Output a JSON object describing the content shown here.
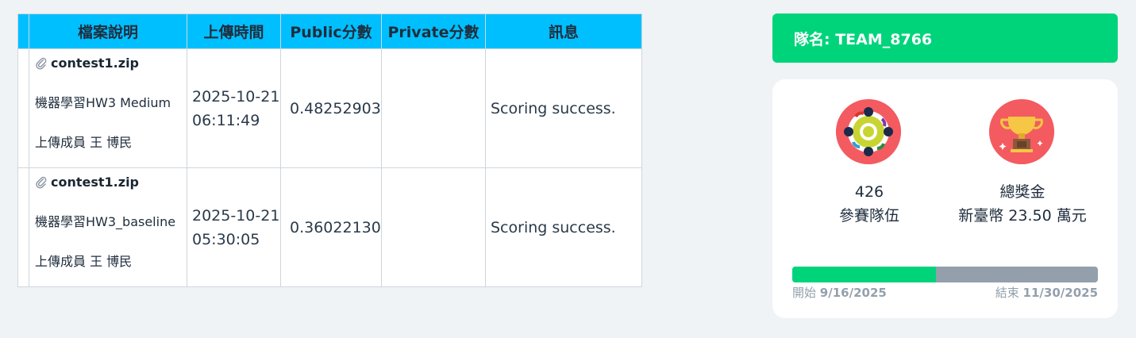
{
  "table": {
    "headers": [
      "檔案說明",
      "上傳時間",
      "Public分數",
      "Private分數",
      "訊息"
    ],
    "rows": [
      {
        "file": "contest1.zip",
        "description": "機器學習HW3 Medium",
        "uploader": "上傳成員 王 博民",
        "date": "2025-10-21",
        "time": "06:11:49",
        "public_score": "0.48252903",
        "private_score": "",
        "message": "Scoring success."
      },
      {
        "file": "contest1.zip",
        "description": "機器學習HW3_baseline",
        "uploader": "上傳成員 王 博民",
        "date": "2025-10-21",
        "time": "05:30:05",
        "public_score": "0.36022130",
        "private_score": "",
        "message": "Scoring success."
      }
    ]
  },
  "team": {
    "label": "隊名: TEAM_8766"
  },
  "stats": {
    "teams_count": "426",
    "teams_label": "參賽隊伍",
    "prize_label": "總獎金",
    "prize_value": "新臺幣 23.50 萬元"
  },
  "timeline": {
    "progress": 0.47,
    "start_label": "開始",
    "start_date": "9/16/2025",
    "end_label": "結束",
    "end_date": "11/30/2025"
  },
  "icons": {
    "attachment": "paperclip-icon",
    "teams": "teams-circle-icon",
    "prize": "trophy-icon"
  },
  "colors": {
    "header_bg": "#00bfff",
    "team_banner": "#00d47b",
    "progress_fill": "#00d47b",
    "progress_track": "#93a0ac",
    "icon_bg": "#f35b61"
  }
}
